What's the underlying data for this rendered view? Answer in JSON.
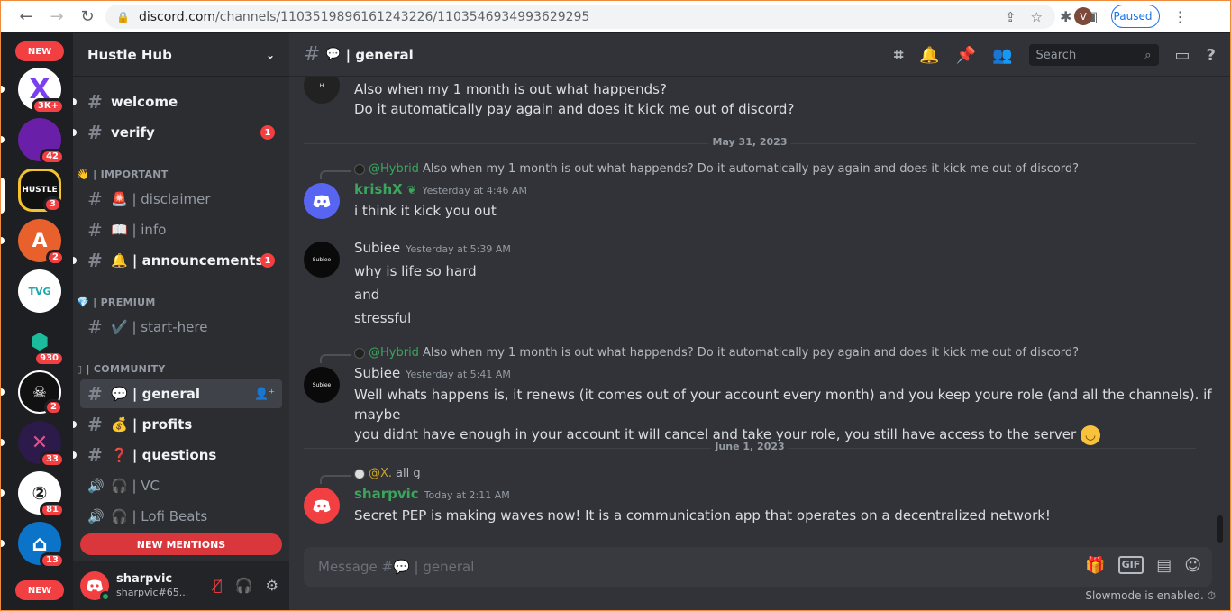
{
  "browser": {
    "url_host": "discord.com",
    "url_path": "/channels/1103519896161243226/1103546934993629295",
    "profile_initial": "V",
    "profile_status": "Paused"
  },
  "rail": {
    "new_top": "NEW",
    "new_bottom": "NEW",
    "servers": [
      {
        "label": "X",
        "badge": "3K+"
      },
      {
        "label": "",
        "badge": "42"
      },
      {
        "label": "HUSTLE",
        "badge": "3"
      },
      {
        "label": "A",
        "badge": "2"
      },
      {
        "label": "TVG",
        "badge": ""
      },
      {
        "label": "",
        "badge": "930"
      },
      {
        "label": "",
        "badge": "2"
      },
      {
        "label": "",
        "badge": "33"
      },
      {
        "label": "",
        "badge": "81"
      },
      {
        "label": "",
        "badge": "13"
      }
    ]
  },
  "sidebar": {
    "guild_name": "Hustle Hub",
    "channels": {
      "welcome": "welcome",
      "verify": "verify",
      "verify_badge": "1",
      "cat_important": "👋 | IMPORTANT",
      "disclaimer": "🚨 | disclaimer",
      "info": "📖 | info",
      "announcements": "🔔 | announcements",
      "announcements_badge": "1",
      "cat_premium": "💎 | PREMIUM",
      "start_here": "✔️ | start-here",
      "cat_community": "▯ | COMMUNITY",
      "general": "💬 | general",
      "profits": "💰 | profits",
      "questions": "❓ | questions",
      "vc": "🎧 | VC",
      "lofi": "🎧 | Lofi Beats"
    },
    "new_mentions": "NEW MENTIONS",
    "user": {
      "name": "sharpvic",
      "tag": "sharpvic#65..."
    }
  },
  "header": {
    "channel": "general",
    "search_placeholder": "Search"
  },
  "messages": {
    "top_line1": "Also when my 1 month is out what happends?",
    "top_line2": "Do it automatically pay again and does it kick me out of discord?",
    "date1": "May 31, 2023",
    "m1_reply_user": "@Hybrid",
    "m1_reply_text": "Also when my 1 month is out what happends? Do it automatically pay again and does it kick me out of discord?",
    "m1_user": "krishX",
    "m1_time": "Yesterday at 4:46 AM",
    "m1_text": "i think it kick you out",
    "m2_user": "Subiee",
    "m2_time": "Yesterday at 5:39 AM",
    "m2_line1": "why is life so hard",
    "m2_line2": "and",
    "m2_line3": "stressful",
    "m3_reply_user": "@Hybrid",
    "m3_reply_text": "Also when my 1 month is out what happends? Do it automatically pay again and does it kick me out of discord?",
    "m3_user": "Subiee",
    "m3_time": "Yesterday at 5:41 AM",
    "m3_line1": "Well whats happens is, it renews (it comes out of your account every month) and you keep youre role (and all the channels). if maybe",
    "m3_line2": "you didnt have enough in your account it will cancel and take your role, you still have access to the server",
    "date2": "June 1, 2023",
    "m4_reply_user": "@X.",
    "m4_reply_text": "all g",
    "m4_user": "sharpvic",
    "m4_time": "Today at 2:11 AM",
    "m4_text": "Secret PEP is making waves now! It is a communication app that operates on a decentralized network!"
  },
  "composer": {
    "placeholder": "Message #💬 | general",
    "slowmode": "Slowmode is enabled."
  },
  "colors": {
    "krishx": "#3ba55c",
    "sharpvic": "#3ba55c",
    "hybrid": "#3ba55c",
    "x_user": "#c9a227"
  }
}
